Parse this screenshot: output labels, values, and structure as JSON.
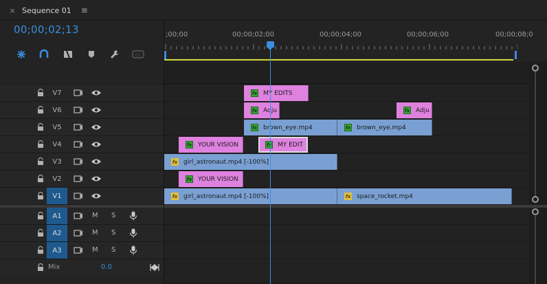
{
  "tab": {
    "title": "Sequence 01",
    "close": "×",
    "menu": "≡"
  },
  "timecode": "00;00;02;13",
  "toolbar": [
    "snap-icon",
    "linked-selection-icon",
    "add-edit-icon",
    "marker-icon",
    "wrench-icon",
    "captions-icon"
  ],
  "ruler_labels": [
    ";00;00",
    "00;00;02;00",
    "00;00;04;00",
    "00;00;06;00",
    "00;00;08;0"
  ],
  "video_tracks": [
    {
      "name": "V7",
      "active": false
    },
    {
      "name": "V6",
      "active": false
    },
    {
      "name": "V5",
      "active": false
    },
    {
      "name": "V4",
      "active": false
    },
    {
      "name": "V3",
      "active": false
    },
    {
      "name": "V2",
      "active": false
    },
    {
      "name": "V1",
      "active": true
    }
  ],
  "audio_tracks": [
    {
      "name": "A1",
      "m": "M",
      "s": "S"
    },
    {
      "name": "A2",
      "m": "M",
      "s": "S"
    },
    {
      "name": "A3",
      "m": "M",
      "s": "S"
    }
  ],
  "mix": {
    "label": "Mix",
    "value": "0.0"
  },
  "clips": {
    "v7_my_edits": "MY EDITS",
    "v6_adju_1": "Adju",
    "v6_adju_2": "Adju",
    "v5_brown_eye_1": "brown_eye.mp4",
    "v5_brown_eye_2": "brown_eye.mp4",
    "v4_your_vision": "YOUR VISION",
    "v4_my_edit": "MY EDIT",
    "v3_girl_astronaut": "girl_astronaut.mp4 [-100%]",
    "v2_your_vision": "YOUR VISION",
    "v1_girl_astronaut": "girl_astronaut.mp4 [-100%]",
    "v1_space_rocket": "space_rocket.mp4"
  },
  "fx_label": "fx",
  "colors": {
    "accent": "#3a8fdd",
    "video_clip": "#7aa0d3",
    "adjustment_clip": "#df82df",
    "work_area": "#d4d43a",
    "active_track": "#1e5a8e"
  }
}
